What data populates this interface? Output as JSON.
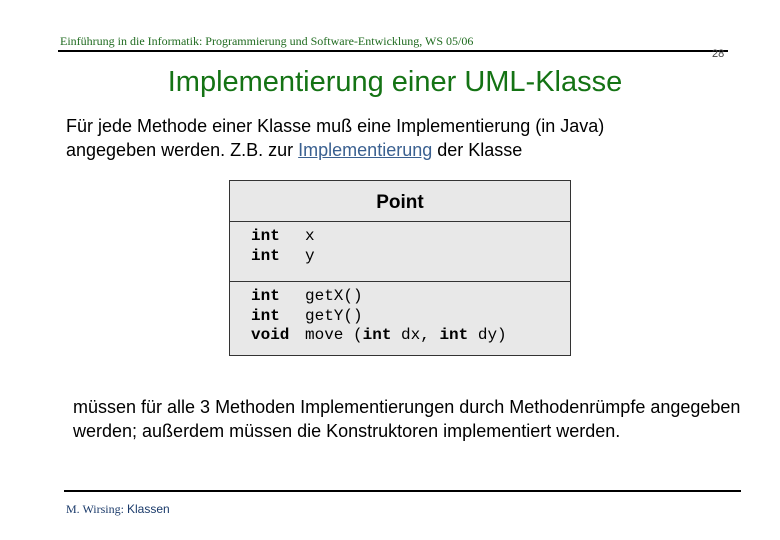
{
  "header": {
    "course": "Einführung in die Informatik: Programmierung und Software-Entwicklung, WS 05/06",
    "page_number": "28"
  },
  "title": "Implementierung einer UML-Klasse",
  "intro": {
    "line1": "Für jede Methode einer Klasse muß eine Implementierung (in Java)",
    "line2_pre": "angegeben werden. Z.B. zur ",
    "line2_link": "Implementierung",
    "line2_post": " der Klasse"
  },
  "uml": {
    "class_name": "Point",
    "attributes": [
      {
        "type": "int",
        "name": "x"
      },
      {
        "type": "int",
        "name": "y"
      }
    ],
    "operations": [
      {
        "type": "int",
        "name": "getX()"
      },
      {
        "type": "int",
        "name": "getY()"
      },
      {
        "type": "void",
        "name": "move (",
        "p1t": "int",
        "p1": " dx, ",
        "p2t": "int",
        "p2": " dy)"
      }
    ]
  },
  "outro": "müssen für alle 3 Methoden Implementierungen durch Methodenrümpfe angegeben werden; außerdem müssen die Konstruktoren implementiert werden.",
  "footer": {
    "author": "M. Wirsing: ",
    "topic": "Klassen"
  }
}
